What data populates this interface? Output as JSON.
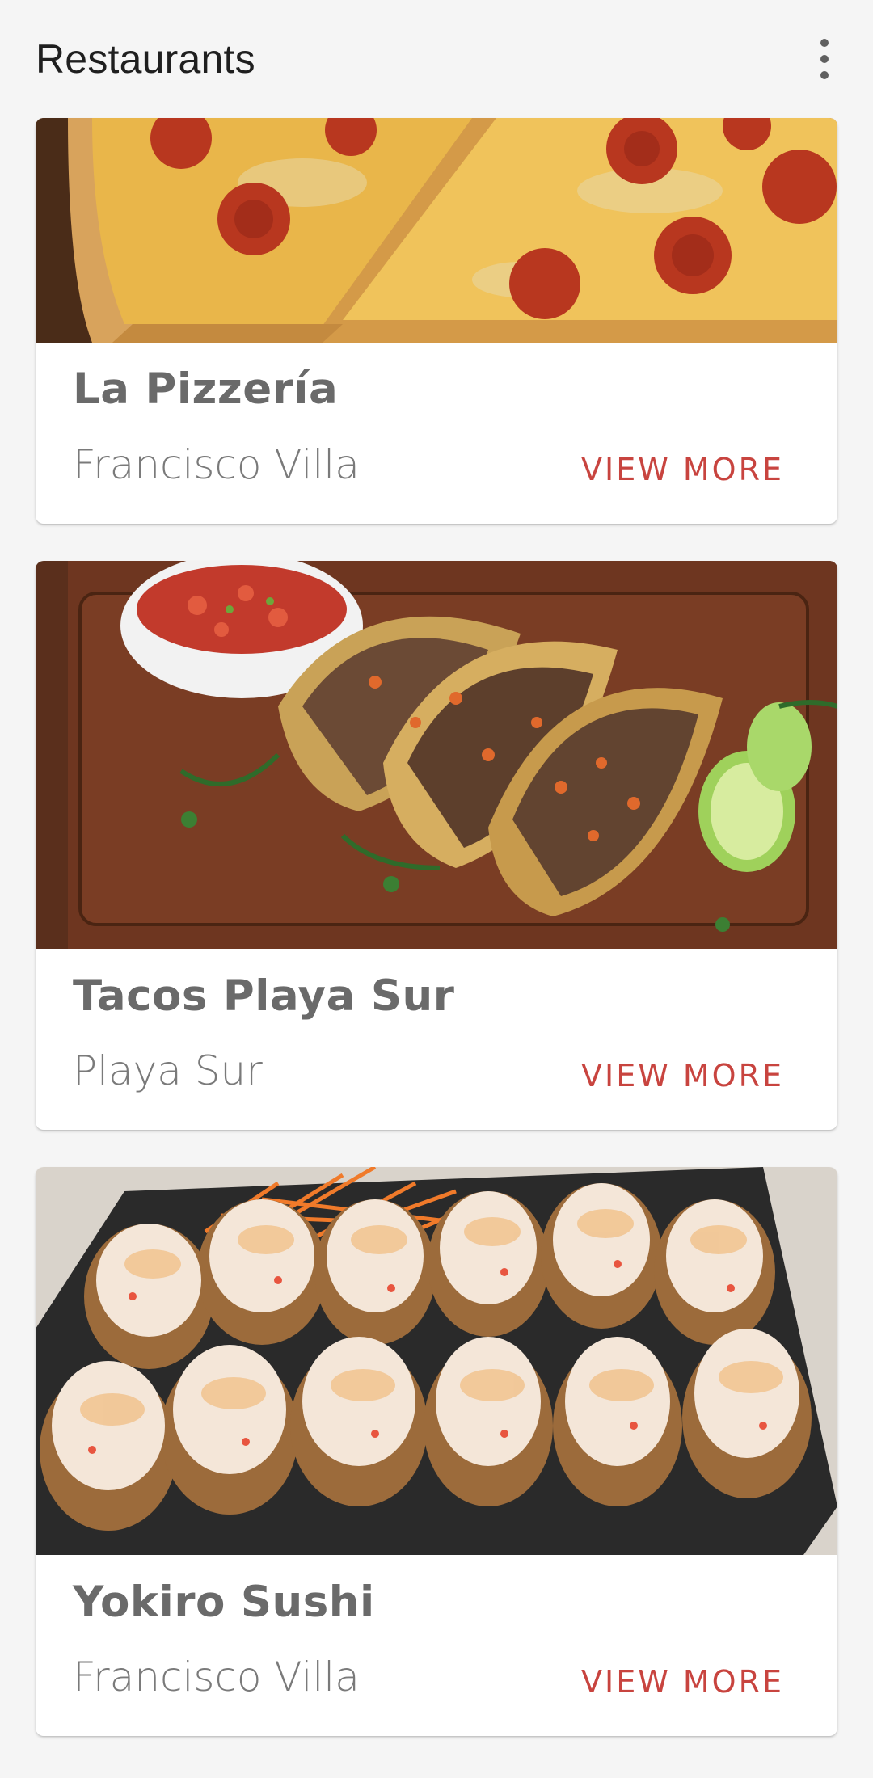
{
  "app_bar": {
    "title": "Restaurants",
    "menu_icon": "more-vert-icon"
  },
  "restaurants": [
    {
      "name": "La Pizzería",
      "location": "Francisco Villa",
      "action_label": "VIEW MORE",
      "image": "pizza-photo"
    },
    {
      "name": "Tacos Playa Sur",
      "location": "Playa Sur",
      "action_label": "VIEW MORE",
      "image": "tacos-photo"
    },
    {
      "name": "Yokiro Sushi",
      "location": "Francisco Villa",
      "action_label": "VIEW MORE",
      "image": "sushi-photo"
    }
  ],
  "colors": {
    "background": "#f5f5f5",
    "card": "#ffffff",
    "accent": "#c8443f",
    "title_text": "#1f1f1f",
    "secondary_text": "#7a7a7a"
  }
}
